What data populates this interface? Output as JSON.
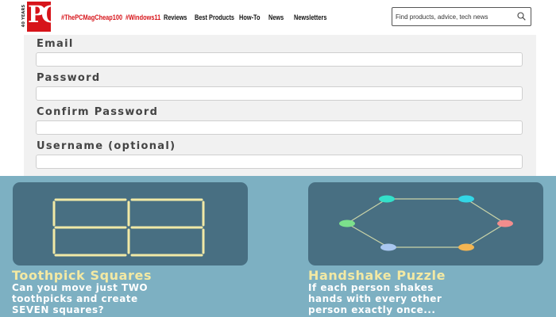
{
  "header": {
    "logo": {
      "years_text": "40 YEARS",
      "letters": "PC"
    },
    "nav": [
      {
        "label": "#ThePCMagCheap100",
        "highlight": true
      },
      {
        "label": "#Windows11",
        "highlight": true
      },
      {
        "label": "Reviews",
        "highlight": false
      },
      {
        "label": "Best Products",
        "highlight": false
      },
      {
        "label": "How-To",
        "highlight": false
      },
      {
        "label": "News",
        "highlight": false
      },
      {
        "label": "Newsletters",
        "highlight": false
      }
    ],
    "search": {
      "placeholder": "Find products, advice, tech news",
      "icon": "search-icon"
    }
  },
  "signup_form": {
    "fields": [
      {
        "label": "Email",
        "value": ""
      },
      {
        "label": "Password",
        "value": ""
      },
      {
        "label": "Confirm Password",
        "value": ""
      },
      {
        "label": "Username (optional)",
        "value": ""
      }
    ]
  },
  "promos": [
    {
      "title": "Toothpick Squares",
      "description": [
        "Can you move just TWO",
        "toothpicks and create",
        "SEVEN squares?"
      ],
      "icon": "toothpick-grid-icon"
    },
    {
      "title": "Handshake Puzzle",
      "description": [
        "If each person shakes",
        "hands with every other",
        "person exactly once..."
      ],
      "icon": "handshake-octagon-icon"
    }
  ],
  "colors": {
    "brand_red": "#d7141a",
    "promo_background": "#7db0c2",
    "card_background": "#486f82",
    "promo_title": "#f3e9a3",
    "toothpick": "#f1e9a6",
    "nodes": [
      "#34e0c9",
      "#33d6e6",
      "#f28d8d",
      "#f3b552",
      "#a9c7f0",
      "#7ce08c"
    ]
  }
}
